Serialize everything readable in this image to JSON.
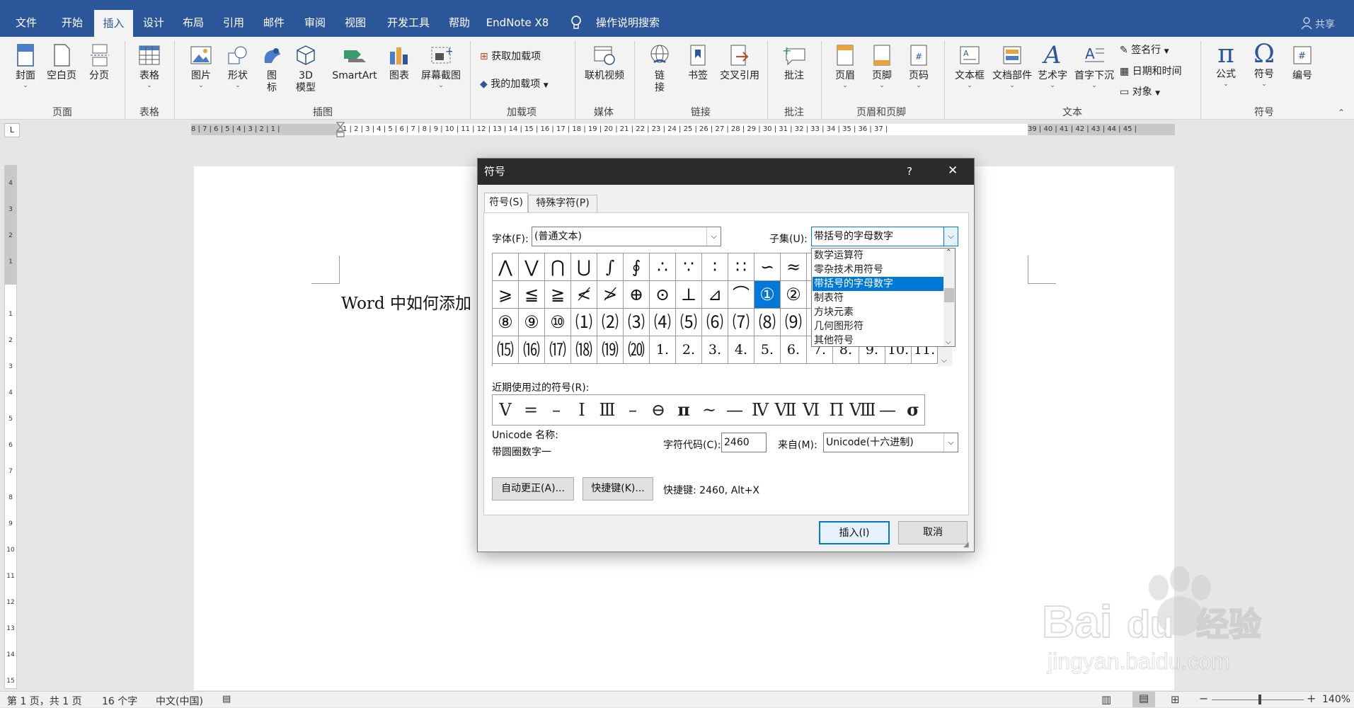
{
  "tabs": [
    "文件",
    "开始",
    "插入",
    "设计",
    "布局",
    "引用",
    "邮件",
    "审阅",
    "视图",
    "开发工具",
    "帮助",
    "EndNote X8"
  ],
  "active_tab": "插入",
  "tell_me": "操作说明搜索",
  "share": "共享",
  "ribbon": {
    "buttons": [
      {
        "label": "封面",
        "icon": "cover-page-icon"
      },
      {
        "label": "空白页",
        "icon": "blank-page-icon"
      },
      {
        "label": "分页",
        "icon": "page-break-icon"
      },
      {
        "label": "表格",
        "icon": "table-icon"
      },
      {
        "label": "图片",
        "icon": "picture-icon"
      },
      {
        "label": "形状",
        "icon": "shapes-icon"
      },
      {
        "label": "图标",
        "icon": "icons-icon"
      },
      {
        "label": "3D 模型",
        "icon": "3d-model-icon"
      },
      {
        "label": "SmartArt",
        "icon": "smartart-icon"
      },
      {
        "label": "图表",
        "icon": "chart-icon"
      },
      {
        "label": "屏幕截图",
        "icon": "screenshot-icon"
      },
      {
        "label": "联机视频",
        "icon": "online-video-icon"
      },
      {
        "label": "链接",
        "icon": "link-icon"
      },
      {
        "label": "书签",
        "icon": "bookmark-icon"
      },
      {
        "label": "交叉引用",
        "icon": "cross-reference-icon"
      },
      {
        "label": "批注",
        "icon": "comment-icon"
      },
      {
        "label": "页眉",
        "icon": "header-icon"
      },
      {
        "label": "页脚",
        "icon": "footer-icon"
      },
      {
        "label": "页码",
        "icon": "page-number-icon"
      },
      {
        "label": "文本框",
        "icon": "text-box-icon"
      },
      {
        "label": "文档部件",
        "icon": "quick-parts-icon"
      },
      {
        "label": "艺术字",
        "icon": "wordart-icon"
      },
      {
        "label": "首字下沉",
        "icon": "drop-cap-icon"
      },
      {
        "label": "公式",
        "icon": "equation-icon"
      },
      {
        "label": "符号",
        "icon": "symbol-icon"
      },
      {
        "label": "编号",
        "icon": "number-icon"
      }
    ],
    "small": {
      "get_addins": "获取加载项",
      "my_addins": "我的加载项",
      "signature": "签名行",
      "datetime": "日期和时间",
      "object": "对象"
    },
    "groups": [
      "页面",
      "表格",
      "插图",
      "加载项",
      "媒体",
      "链接",
      "批注",
      "页眉和页脚",
      "文本",
      "符号"
    ]
  },
  "ruler": {
    "left": "8 | 7 | 6 | 5 | 4 | 3 | 2 | 1 |",
    "main": "1 | 2 | 3 | 4 | 5 | 6 | 7 | 8 | 9 | 10 | 11 | 12 | 13 | 14 | 15 | 16 | 17 | 18 | 19 | 20 | 21 | 22 | 23 | 24 | 25 | 26 | 27 | 28 | 29 | 30 | 31 | 32 | 33 | 34 | 35 | 36 | 37 |",
    "right": "39 | 40 | 41 | 42 | 43 | 44 | 45 |"
  },
  "document": {
    "text": "Word 中如何添加"
  },
  "dialog": {
    "title": "符号",
    "help": "?",
    "close": "✕",
    "tabs": [
      "符号(S)",
      "特殊字符(P)"
    ],
    "font_label": "字体(F):",
    "font_value": "(普通文本)",
    "subset_label": "子集(U):",
    "subset_value": "带括号的字母数字",
    "subset_options": [
      "数学运算符",
      "零杂技术用符号",
      "带括号的字母数字",
      "制表符",
      "方块元素",
      "几何图形符",
      "其他符号"
    ],
    "subset_selected": 2,
    "grid": [
      [
        "⋀",
        "⋁",
        "⋂",
        "⋃",
        "∫",
        "∮",
        "∴",
        "∵",
        "∶",
        "∷",
        "∽",
        "≈",
        "",
        "",
        "",
        "",
        ""
      ],
      [
        "⩾",
        "≦",
        "≧",
        "≮",
        "≯",
        "⊕",
        "⊙",
        "⊥",
        "⊿",
        "⌒",
        "①",
        "②",
        "",
        "",
        "",
        "",
        ""
      ],
      [
        "⑧",
        "⑨",
        "⑩",
        "⑴",
        "⑵",
        "⑶",
        "⑷",
        "⑸",
        "⑹",
        "⑺",
        "⑻",
        "⑼",
        "",
        "",
        "",
        "",
        ""
      ],
      [
        "⒂",
        "⒃",
        "⒄",
        "⒅",
        "⒆",
        "⒇",
        "1.",
        "2.",
        "3.",
        "4.",
        "5.",
        "6.",
        "7.",
        "8.",
        "9.",
        "10.",
        "11."
      ]
    ],
    "selected_symbol": "①",
    "recent_label": "近期使用过的符号(R):",
    "recent": [
      "Ⅴ",
      "=",
      "–",
      "Ⅰ",
      "Ⅲ",
      "–",
      "⊖",
      "π",
      "~",
      "—",
      "Ⅳ",
      "Ⅶ",
      "Ⅵ",
      "Π",
      "Ⅷ",
      "—",
      "σ"
    ],
    "unicode_name_label": "Unicode 名称:",
    "unicode_name": "带圆圈数字一",
    "char_code_label": "字符代码(C):",
    "char_code": "2460",
    "from_label": "来自(M):",
    "from_value": "Unicode(十六进制)",
    "autocorrect": "自动更正(A)...",
    "shortcut_btn": "快捷键(K)...",
    "shortcut_text": "快捷键: 2460, Alt+X",
    "insert": "插入(I)",
    "cancel": "取消"
  },
  "status": {
    "page": "第 1 页，共 1 页",
    "words": "16 个字",
    "lang": "中文(中国)",
    "zoom": "140%"
  },
  "watermark": {
    "brand": "Baidu经验",
    "url": "jingyan.baidu.com"
  },
  "colors": {
    "accent": "#2b579a",
    "selection": "#0078d7"
  }
}
